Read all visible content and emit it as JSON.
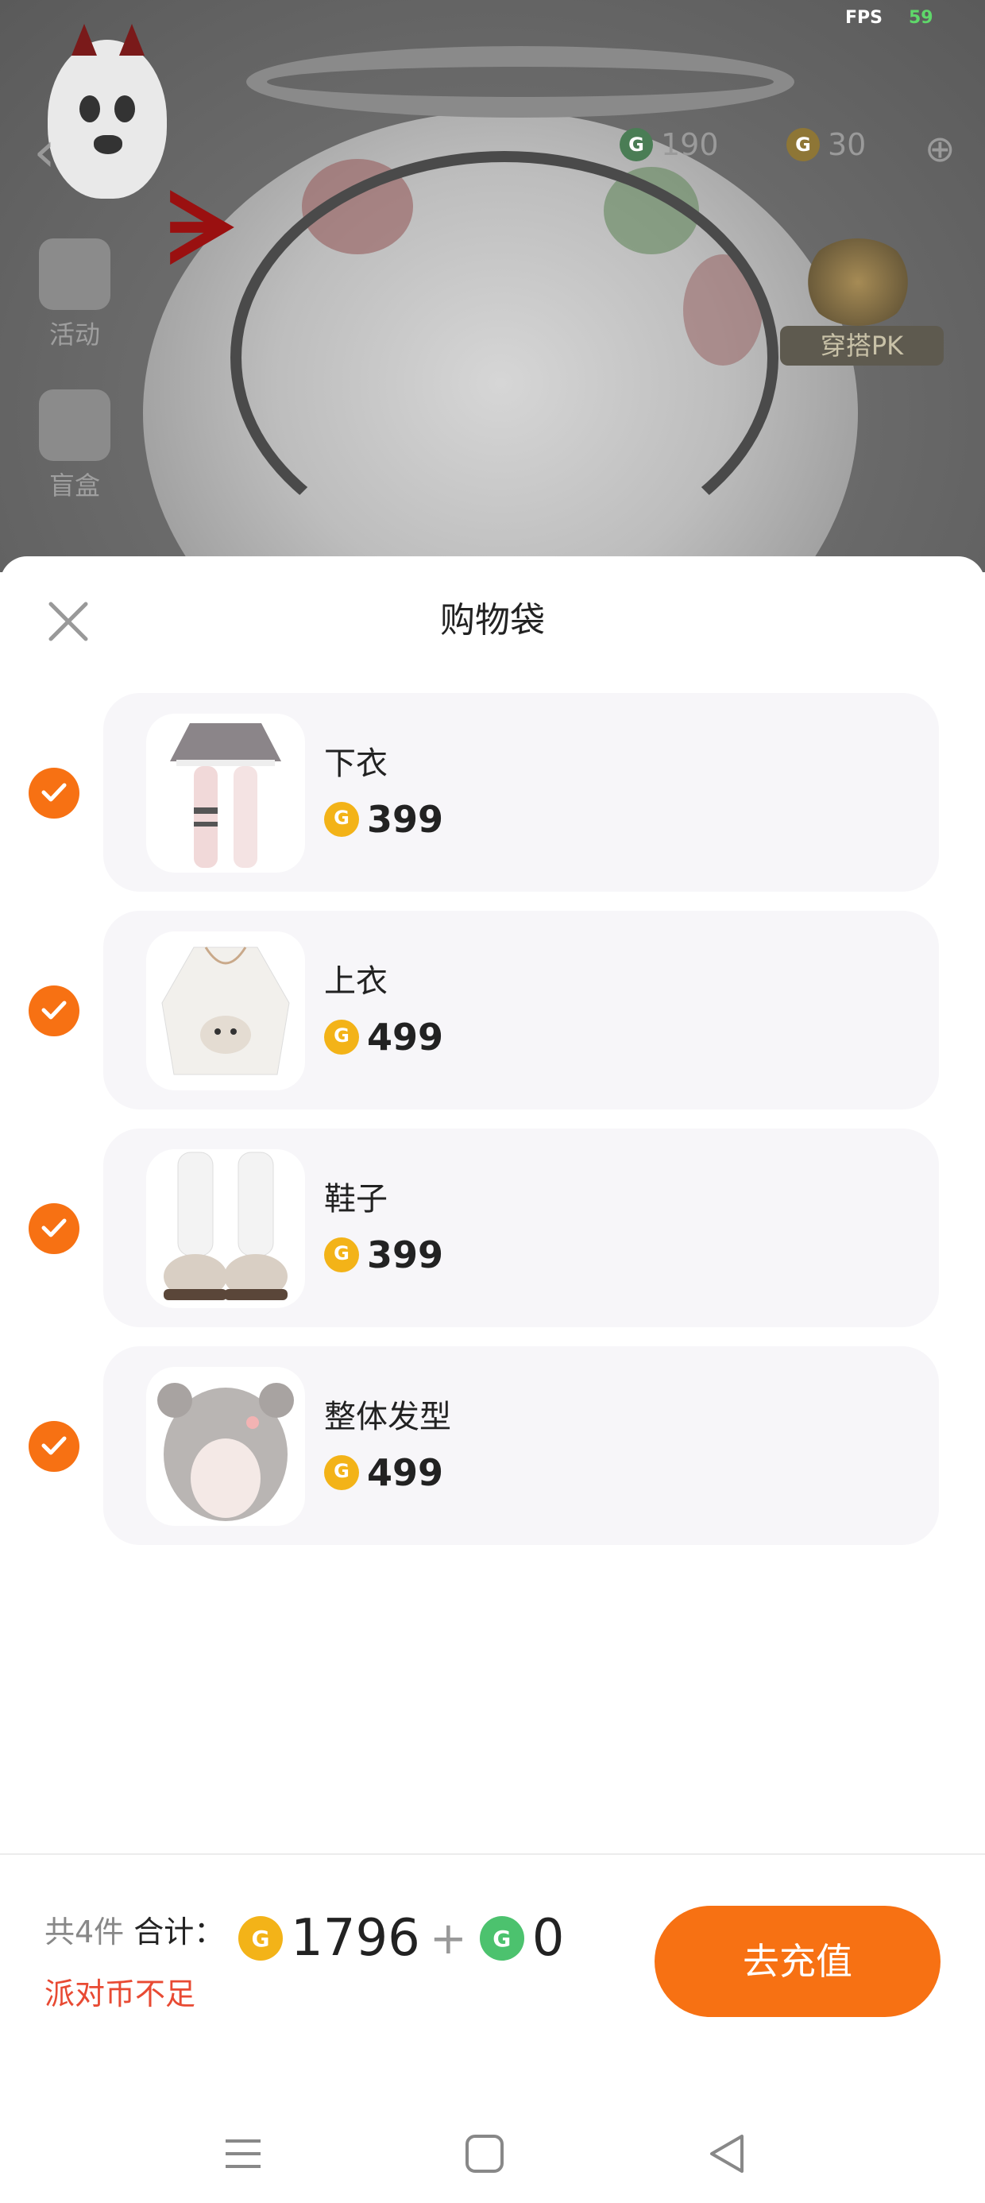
{
  "status": {
    "fps_label": "FPS",
    "fps_value": "59"
  },
  "topbar": {
    "green_coins": "190",
    "gold_coins": "30"
  },
  "left_tools": [
    "活动",
    "盲盒"
  ],
  "pk_button": "穿搭PK",
  "sheet": {
    "title": "购物袋"
  },
  "items": [
    {
      "name": "下衣",
      "price": "399"
    },
    {
      "name": "上衣",
      "price": "499"
    },
    {
      "name": "鞋子",
      "price": "399"
    },
    {
      "name": "整体发型",
      "price": "499"
    }
  ],
  "footer": {
    "count_label": "共4件",
    "total_label": "合计：",
    "gold_total": "1796",
    "plus": "+",
    "green_total": "0",
    "warning": "派对币不足",
    "recharge_button": "去充值"
  },
  "colors": {
    "accent": "#f77113",
    "warning": "#e84a33",
    "gold": "#f3b318",
    "green": "#4cc26e"
  },
  "icons": [
    "close-icon",
    "check-icon",
    "gold-coin-icon",
    "green-coin-icon",
    "menu-icon",
    "home-icon",
    "back-icon"
  ]
}
